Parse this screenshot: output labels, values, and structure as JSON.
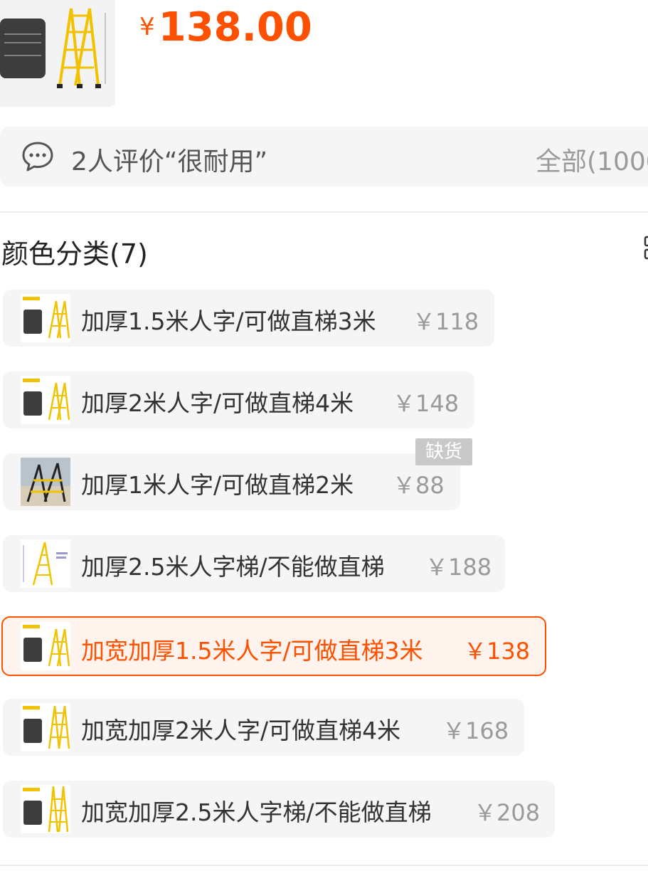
{
  "product": {
    "price_symbol": "¥",
    "price": "138.00"
  },
  "review": {
    "text": "2人评价“很耐用”",
    "all_label": "全部(1000"
  },
  "sku": {
    "title": "颜色分类(7)",
    "options": [
      {
        "name": "加厚1.5米人字/可做直梯3米",
        "price": "￥118"
      },
      {
        "name": "加厚2米人字/可做直梯4米",
        "price": "￥148"
      },
      {
        "name": "加厚1米人字/可做直梯2米",
        "price": "￥88",
        "badge": "缺货"
      },
      {
        "name": "加厚2.5米人字梯/不能做直梯",
        "price": "￥188"
      },
      {
        "name": "加宽加厚1.5米人字/可做直梯3米",
        "price": "￥138",
        "selected": true
      },
      {
        "name": "加宽加厚2米人字/可做直梯4米",
        "price": "￥168"
      },
      {
        "name": "加宽加厚2.5米人字梯/不能做直梯",
        "price": "￥208"
      }
    ]
  },
  "colors": {
    "accent": "#ff5000",
    "ladder": "#f2c200",
    "muted": "#9a9a9a"
  }
}
